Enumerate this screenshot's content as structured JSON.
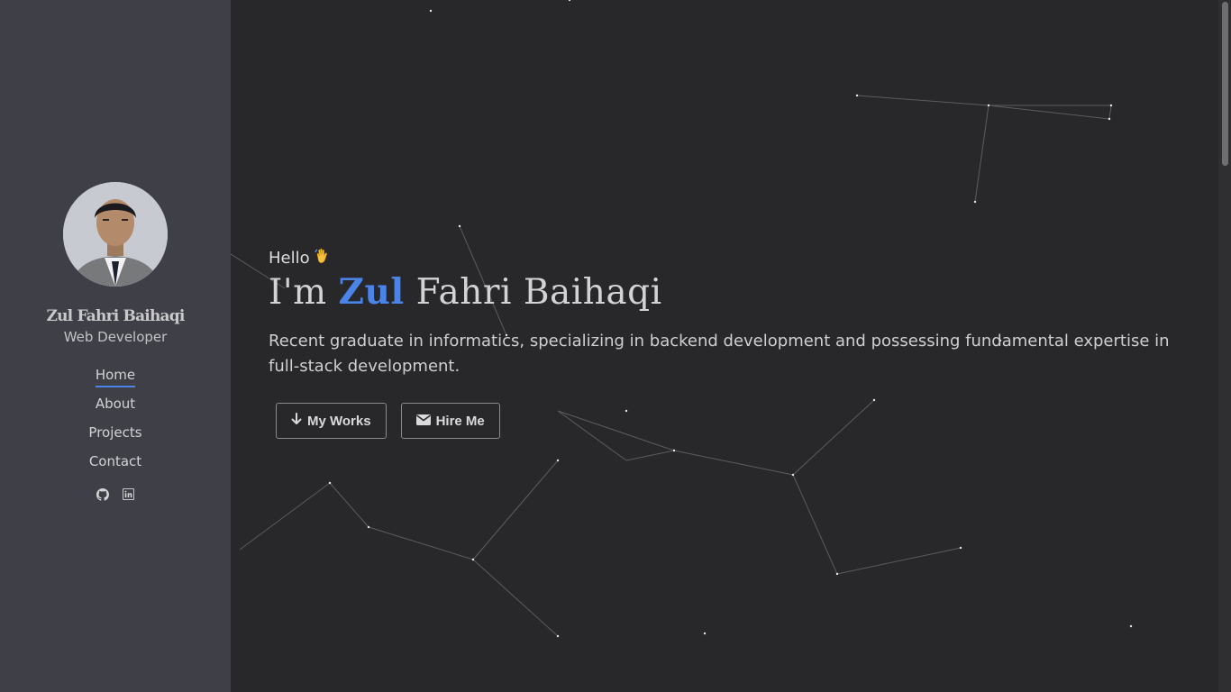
{
  "profile": {
    "name": "Zul Fahri Baihaqi",
    "role": "Web Developer"
  },
  "nav": {
    "items": [
      {
        "label": "Home",
        "active": true
      },
      {
        "label": "About"
      },
      {
        "label": "Projects"
      },
      {
        "label": "Contact"
      }
    ]
  },
  "social": {
    "icons": [
      "github-icon",
      "linkedin-icon"
    ]
  },
  "hero": {
    "greeting": "Hello",
    "greeting_emoji": "👋",
    "headline_prefix": "I'm",
    "headline_accent": "Zul",
    "headline_rest": "Fahri Baihaqi",
    "description": "Recent graduate in informatics, specializing in backend development and possessing fundamental expertise in full-stack development.",
    "buttons": {
      "works": "My Works",
      "hire": "Hire Me"
    }
  },
  "colors": {
    "accent": "#4a84e8",
    "sidebar": "#3f4047",
    "background": "#28282b"
  }
}
